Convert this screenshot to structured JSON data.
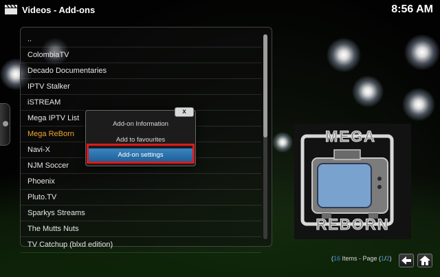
{
  "header": {
    "title": "Videos  - Add-ons",
    "clock": "8:56 AM"
  },
  "list": {
    "items": [
      {
        "label": ".."
      },
      {
        "label": "ColombiaTV"
      },
      {
        "label": "Decado Documentaries"
      },
      {
        "label": "IPTV Stalker"
      },
      {
        "label": "iSTREAM"
      },
      {
        "label": "Mega IPTV List"
      },
      {
        "label": "Mega ReBorn"
      },
      {
        "label": "Navi-X"
      },
      {
        "label": "NJM Soccer"
      },
      {
        "label": "Phoenix"
      },
      {
        "label": "Pluto.TV"
      },
      {
        "label": "Sparkys Streams"
      },
      {
        "label": "The Mutts Nuts"
      },
      {
        "label": "TV Catchup (blxd edition)"
      }
    ],
    "focused_index": 6
  },
  "context_menu": {
    "close_label": "x",
    "items": [
      "Add-on Information",
      "Add to favourites",
      "Add-on settings"
    ],
    "selected_index": 2
  },
  "thumbnail": {
    "logo_top": "MEGA",
    "logo_bottom": "REBORN"
  },
  "footer": {
    "count": "16",
    "items_label": " Items - Page (",
    "page_current": "1",
    "page_sep": "/",
    "page_total": "2",
    "close_paren": ")"
  },
  "colors": {
    "focus": "#f3a733",
    "selection": "#2a73b0",
    "highlight_box": "#e01919",
    "footer_number": "#3a8fe0"
  },
  "icons": {
    "header": "clapperboard-icon",
    "back": "back-arrow-icon",
    "home": "home-icon"
  }
}
